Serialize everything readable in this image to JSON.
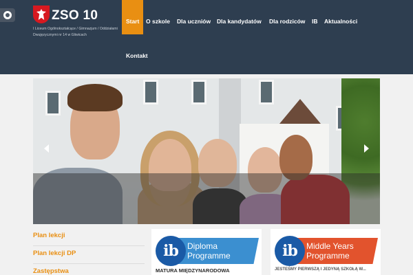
{
  "header": {
    "title": "ZSO 10",
    "subtitle": "I Liceum Ogólnokształcące / Gimnazjum / Oddziałami Dwujęzycznymi nr 14 w Gliwicach",
    "accessibility_icon": "accessibility-icon",
    "logo_icon": "eagle-emblem-icon"
  },
  "nav": {
    "items": [
      {
        "label": "Start",
        "active": true
      },
      {
        "label": "O szkole"
      },
      {
        "label": "Dla uczniów"
      },
      {
        "label": "Dla kandydatów"
      },
      {
        "label": "Dla rodziców"
      },
      {
        "label": "IB"
      },
      {
        "label": "Aktualności"
      },
      {
        "label": "Kontakt"
      }
    ]
  },
  "slider": {
    "prev_icon": "chevron-left-icon",
    "next_icon": "chevron-right-icon"
  },
  "sidebar": {
    "links": [
      {
        "label": "Plan lekcji"
      },
      {
        "label": "Plan lekcji DP"
      },
      {
        "label": "Zastępstwa"
      }
    ]
  },
  "cards": [
    {
      "logo": "ib",
      "line1": "Diploma",
      "line2": "Programme",
      "caption": "MATURA MIĘDZYNARODOWA",
      "color": "#3b8fd0"
    },
    {
      "logo": "ib",
      "line1": "Middle Years",
      "line2": "Programme",
      "caption": "JESTEŚMY PIERWSZĄ I JEDYNĄ SZKOŁĄ W...",
      "color": "#e2532d"
    }
  ],
  "colors": {
    "header_bg": "#2e3e50",
    "accent": "#e98f12",
    "ib_blue": "#1a5aa6"
  }
}
